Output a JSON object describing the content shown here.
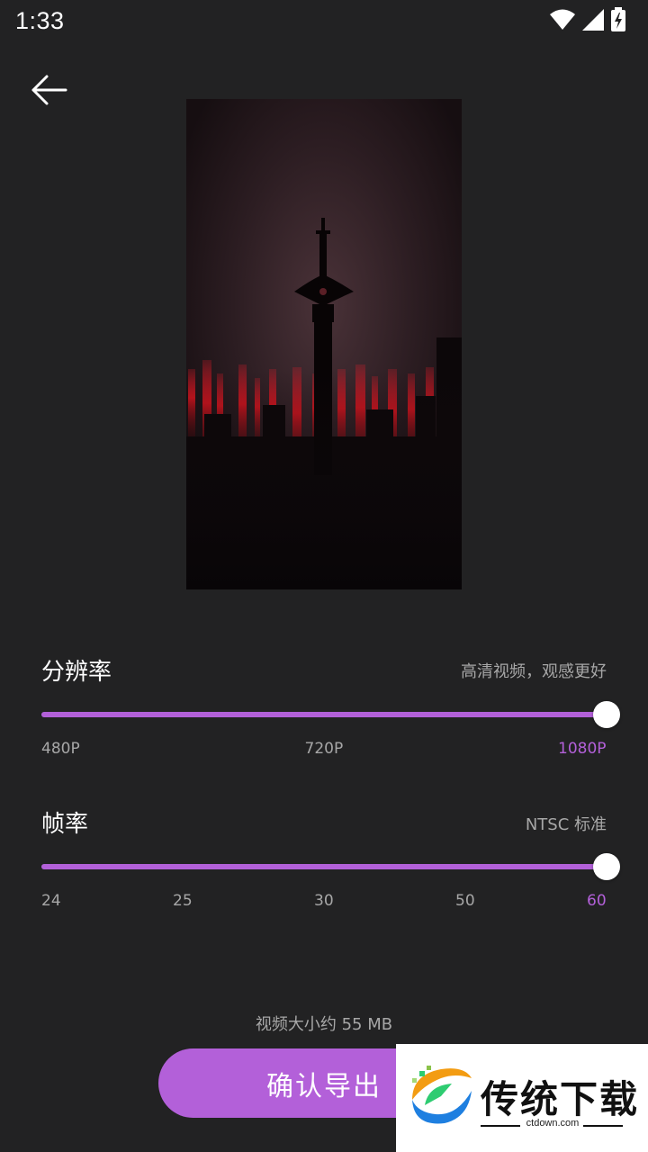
{
  "status_bar": {
    "time": "1:33",
    "icons": [
      "wifi-icon",
      "signal-icon",
      "battery-charging-icon"
    ]
  },
  "header": {
    "back_icon": "arrow-left-icon"
  },
  "preview": {
    "description_icon": "video-thumbnail"
  },
  "resolution": {
    "title": "分辨率",
    "hint": "高清视频，观感更好",
    "options": [
      "480P",
      "720P",
      "1080P"
    ],
    "selected": "1080P",
    "value_fraction": 1.0
  },
  "frame_rate": {
    "title": "帧率",
    "hint": "NTSC 标准",
    "options": [
      "24",
      "25",
      "30",
      "50",
      "60"
    ],
    "selected": "60",
    "value_fraction": 1.0
  },
  "footer": {
    "file_size": "视频大小约 55 MB",
    "confirm_label": "确认导出"
  },
  "watermark": {
    "title": "传统下载",
    "site": "ctdown.com"
  },
  "colors": {
    "background": "#222223",
    "accent": "#b360d9",
    "muted_text": "#a7a7a7",
    "track": "#444446"
  }
}
